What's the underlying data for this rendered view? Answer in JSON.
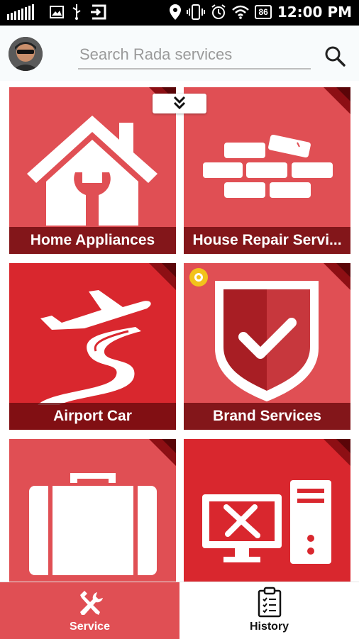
{
  "status_bar": {
    "time": "12:00 PM",
    "battery": "86",
    "icons": [
      "signal-icon",
      "image-icon",
      "usb-icon",
      "exit-icon",
      "location-icon",
      "vibrate-icon",
      "alarm-icon",
      "wifi-icon",
      "battery-icon"
    ]
  },
  "header": {
    "avatar": "user-avatar",
    "search_placeholder": "Search Rada services",
    "search_value": ""
  },
  "tiles": [
    {
      "label": "Home Appliances",
      "icon": "house-wrench-icon"
    },
    {
      "label": "House Repair Servi...",
      "icon": "bricks-icon"
    },
    {
      "label": "Airport Car",
      "icon": "plane-road-icon"
    },
    {
      "label": "Brand Services",
      "icon": "shield-check-icon"
    },
    {
      "label": "",
      "icon": "suitcase-icon"
    },
    {
      "label": "",
      "icon": "computer-tools-icon"
    }
  ],
  "bottom_nav": {
    "service_label": "Service",
    "history_label": "History"
  },
  "colors": {
    "tile_light": "#e04f54",
    "tile_dark": "#d9272e",
    "label_band": "#6e0a0e",
    "marker": "#f2c21b"
  }
}
